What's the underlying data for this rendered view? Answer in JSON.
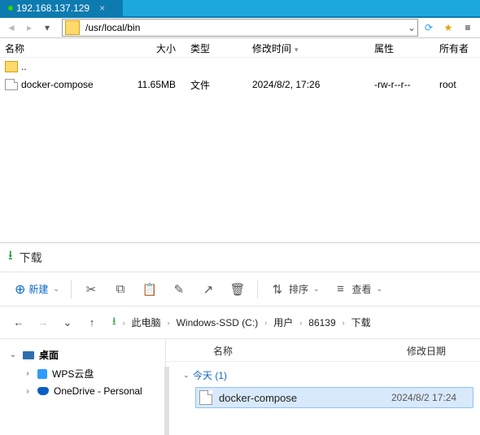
{
  "remote": {
    "tab_title": "192.168.137.129",
    "path": "/usr/local/bin",
    "columns": {
      "name": "名称",
      "size": "大小",
      "type": "类型",
      "modified": "修改时间",
      "attrs": "属性",
      "owner": "所有者"
    },
    "rows": [
      {
        "icon": "folder",
        "name": "..",
        "size": "",
        "type": "",
        "modified": "",
        "attrs": "",
        "owner": ""
      },
      {
        "icon": "file",
        "name": "docker-compose",
        "size": "11.65MB",
        "type": "文件",
        "modified": "2024/8/2, 17:26",
        "attrs": "-rw-r--r--",
        "owner": "root"
      }
    ]
  },
  "explorer": {
    "title": "下载",
    "toolbar": {
      "new": "新建",
      "sort": "排序",
      "view": "查看"
    },
    "nav": {
      "back": "←",
      "fwd": "→",
      "recent": "⌄",
      "up": "↑"
    },
    "breadcrumbs": [
      "此电脑",
      "Windows-SSD (C:)",
      "用户",
      "86139",
      "下载"
    ],
    "tree": {
      "root": "桌面",
      "children": [
        "WPS云盘",
        "OneDrive - Personal"
      ]
    },
    "list": {
      "columns": {
        "name": "名称",
        "modified": "修改日期"
      },
      "group": "今天 (1)",
      "rows": [
        {
          "name": "docker-compose",
          "modified": "2024/8/2 17:24",
          "selected": true
        }
      ]
    }
  }
}
